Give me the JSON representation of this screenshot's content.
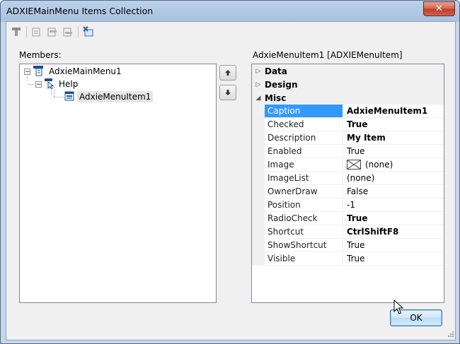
{
  "window": {
    "title": "ADXIEMainMenu Items Collection",
    "close_glyph": "✕"
  },
  "toolbar": {
    "buttons": [
      "add-item-icon",
      "add-separator-icon",
      "insert-item-icon",
      "insert-separator-icon",
      "delete-item-icon"
    ]
  },
  "members": {
    "label": "Members:",
    "tree": [
      {
        "label": "AdxieMainMenu1",
        "expander": "−",
        "icon": "menu-icon"
      },
      {
        "label": "Help",
        "expander": "−",
        "icon": "menu-popup-icon"
      },
      {
        "label": "AdxieMenuItem1",
        "icon": "menu-item-icon",
        "selected": true
      }
    ]
  },
  "properties": {
    "header": "AdxieMenuItem1 [ADXIEMenuItem]",
    "categories": [
      {
        "name": "Data",
        "arrow": "▷"
      },
      {
        "name": "Design",
        "arrow": "▷"
      },
      {
        "name": "Misc",
        "arrow": "◢"
      }
    ],
    "rows": [
      {
        "name": "Caption",
        "value": "AdxieMenuItem1",
        "bold": true,
        "selected": true
      },
      {
        "name": "Checked",
        "value": "True",
        "bold": true
      },
      {
        "name": "Description",
        "value": "My Item",
        "bold": true
      },
      {
        "name": "Enabled",
        "value": "True"
      },
      {
        "name": "Image",
        "value": "(none)",
        "has_image": true
      },
      {
        "name": "ImageList",
        "value": "(none)"
      },
      {
        "name": "OwnerDraw",
        "value": "False"
      },
      {
        "name": "Position",
        "value": "-1"
      },
      {
        "name": "RadioCheck",
        "value": "True",
        "bold": true
      },
      {
        "name": "Shortcut",
        "value": "CtrlShiftF8",
        "bold": true
      },
      {
        "name": "ShowShortcut",
        "value": "True"
      },
      {
        "name": "Visible",
        "value": "True"
      }
    ]
  },
  "ok_label": "OK",
  "colors": {
    "selection": "#3399ff",
    "title_bg": "#bcd1ea"
  }
}
